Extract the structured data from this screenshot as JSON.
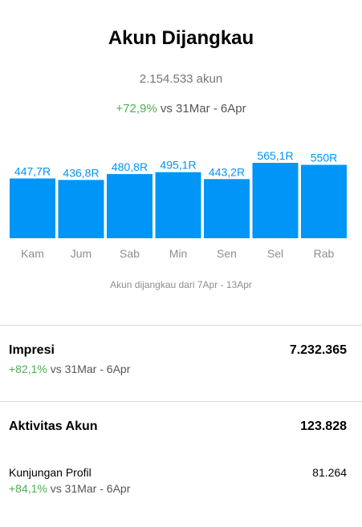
{
  "header": {
    "title": "Akun Dijangkau",
    "total": "2.154.533 akun",
    "delta": "+72,9%",
    "delta_compare": "vs 31Mar - 6Apr"
  },
  "chart_data": {
    "type": "bar",
    "categories": [
      "Kam",
      "Jum",
      "Sab",
      "Min",
      "Sen",
      "Sel",
      "Rab"
    ],
    "values": [
      447.7,
      436.8,
      480.8,
      495.1,
      443.2,
      565.1,
      550
    ],
    "data_labels": [
      "447,7R",
      "436,8R",
      "480,8R",
      "495,1R",
      "443,2R",
      "565,1R",
      "550R"
    ],
    "bar_color": "#0095f6",
    "label_color": "#0095f6",
    "tick_label_color": "#8e8e8e",
    "grid": false,
    "caption": "Akun dijangkau dari 7Apr - 13Apr"
  },
  "impresi": {
    "label": "Impresi",
    "value": "7.232.365",
    "delta": "+82,1%",
    "delta_compare": "vs 31Mar - 6Apr"
  },
  "aktivitas": {
    "label": "Aktivitas Akun",
    "value": "123.828",
    "kunjungan": {
      "label": "Kunjungan Profil",
      "value": "81.264",
      "delta": "+84,1%",
      "delta_compare": "vs 31Mar - 6Apr"
    }
  },
  "colors": {
    "positive": "#4caf50",
    "accent": "#0095f6"
  }
}
